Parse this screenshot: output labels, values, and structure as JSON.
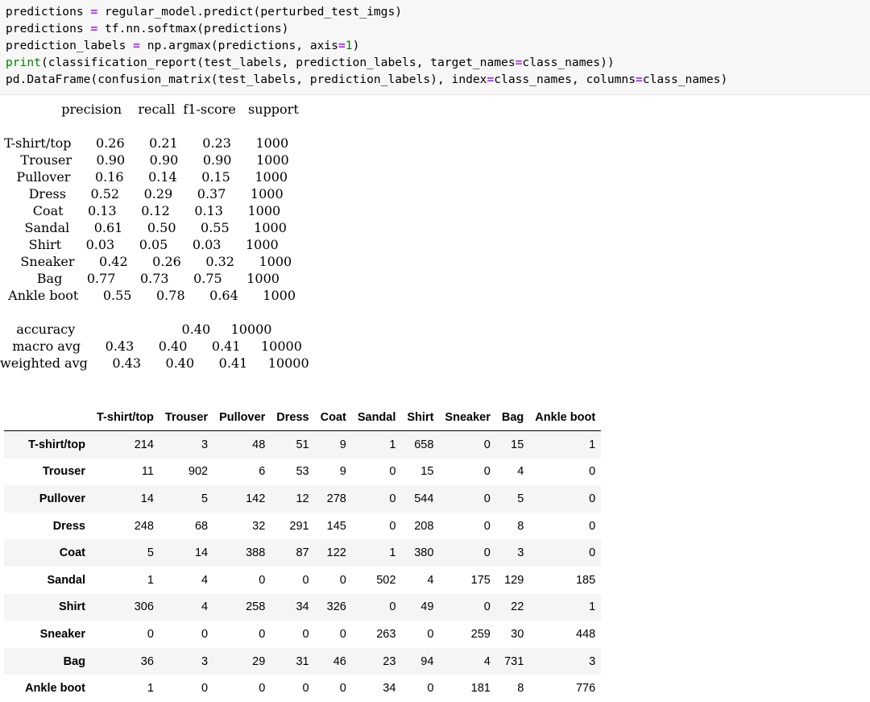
{
  "code": {
    "lines": [
      [
        {
          "t": "predictions "
        },
        {
          "t": "=",
          "c": "op"
        },
        {
          "t": " regular_model.predict(perturbed_test_imgs)"
        }
      ],
      [
        {
          "t": "predictions "
        },
        {
          "t": "=",
          "c": "op"
        },
        {
          "t": " tf.nn.softmax(predictions)"
        }
      ],
      [
        {
          "t": "prediction_labels "
        },
        {
          "t": "=",
          "c": "op"
        },
        {
          "t": " np.argmax(predictions, axis"
        },
        {
          "t": "=",
          "c": "op"
        },
        {
          "t": "1",
          "c": "num"
        },
        {
          "t": ")"
        }
      ],
      [
        {
          "t": "print",
          "c": "kw"
        },
        {
          "t": "(classification_report(test_labels, prediction_labels, target_names"
        },
        {
          "t": "=",
          "c": "op"
        },
        {
          "t": "class_names))"
        }
      ],
      [
        {
          "t": "pd.DataFrame(confusion_matrix(test_labels, prediction_labels), index"
        },
        {
          "t": "=",
          "c": "op"
        },
        {
          "t": "class_names, columns"
        },
        {
          "t": "=",
          "c": "op"
        },
        {
          "t": "class_names)"
        }
      ]
    ]
  },
  "report": {
    "headers": [
      "precision",
      "recall",
      "f1-score",
      "support"
    ],
    "rows": [
      {
        "label": "T-shirt/top",
        "precision": "0.26",
        "recall": "0.21",
        "f1": "0.23",
        "support": "1000"
      },
      {
        "label": "Trouser",
        "precision": "0.90",
        "recall": "0.90",
        "f1": "0.90",
        "support": "1000"
      },
      {
        "label": "Pullover",
        "precision": "0.16",
        "recall": "0.14",
        "f1": "0.15",
        "support": "1000"
      },
      {
        "label": "Dress",
        "precision": "0.52",
        "recall": "0.29",
        "f1": "0.37",
        "support": "1000"
      },
      {
        "label": "Coat",
        "precision": "0.13",
        "recall": "0.12",
        "f1": "0.13",
        "support": "1000"
      },
      {
        "label": "Sandal",
        "precision": "0.61",
        "recall": "0.50",
        "f1": "0.55",
        "support": "1000"
      },
      {
        "label": "Shirt",
        "precision": "0.03",
        "recall": "0.05",
        "f1": "0.03",
        "support": "1000"
      },
      {
        "label": "Sneaker",
        "precision": "0.42",
        "recall": "0.26",
        "f1": "0.32",
        "support": "1000"
      },
      {
        "label": "Bag",
        "precision": "0.77",
        "recall": "0.73",
        "f1": "0.75",
        "support": "1000"
      },
      {
        "label": "Ankle boot",
        "precision": "0.55",
        "recall": "0.78",
        "f1": "0.64",
        "support": "1000"
      }
    ],
    "summary": [
      {
        "label": "accuracy",
        "precision": "",
        "recall": "",
        "f1": "0.40",
        "support": "10000"
      },
      {
        "label": "macro avg",
        "precision": "0.43",
        "recall": "0.40",
        "f1": "0.41",
        "support": "10000"
      },
      {
        "label": "weighted avg",
        "precision": "0.43",
        "recall": "0.40",
        "f1": "0.41",
        "support": "10000"
      }
    ]
  },
  "confusion": {
    "columns": [
      "T-shirt/top",
      "Trouser",
      "Pullover",
      "Dress",
      "Coat",
      "Sandal",
      "Shirt",
      "Sneaker",
      "Bag",
      "Ankle boot"
    ],
    "rows": [
      {
        "label": "T-shirt/top",
        "values": [
          214,
          3,
          48,
          51,
          9,
          1,
          658,
          0,
          15,
          1
        ]
      },
      {
        "label": "Trouser",
        "values": [
          11,
          902,
          6,
          53,
          9,
          0,
          15,
          0,
          4,
          0
        ]
      },
      {
        "label": "Pullover",
        "values": [
          14,
          5,
          142,
          12,
          278,
          0,
          544,
          0,
          5,
          0
        ]
      },
      {
        "label": "Dress",
        "values": [
          248,
          68,
          32,
          291,
          145,
          0,
          208,
          0,
          8,
          0
        ]
      },
      {
        "label": "Coat",
        "values": [
          5,
          14,
          388,
          87,
          122,
          1,
          380,
          0,
          3,
          0
        ]
      },
      {
        "label": "Sandal",
        "values": [
          1,
          4,
          0,
          0,
          0,
          502,
          4,
          175,
          129,
          185
        ]
      },
      {
        "label": "Shirt",
        "values": [
          306,
          4,
          258,
          34,
          326,
          0,
          49,
          0,
          22,
          1
        ]
      },
      {
        "label": "Sneaker",
        "values": [
          0,
          0,
          0,
          0,
          0,
          263,
          0,
          259,
          30,
          448
        ]
      },
      {
        "label": "Bag",
        "values": [
          36,
          3,
          29,
          31,
          46,
          23,
          94,
          4,
          731,
          3
        ]
      },
      {
        "label": "Ankle boot",
        "values": [
          1,
          0,
          0,
          0,
          0,
          34,
          0,
          181,
          8,
          776
        ]
      }
    ]
  }
}
